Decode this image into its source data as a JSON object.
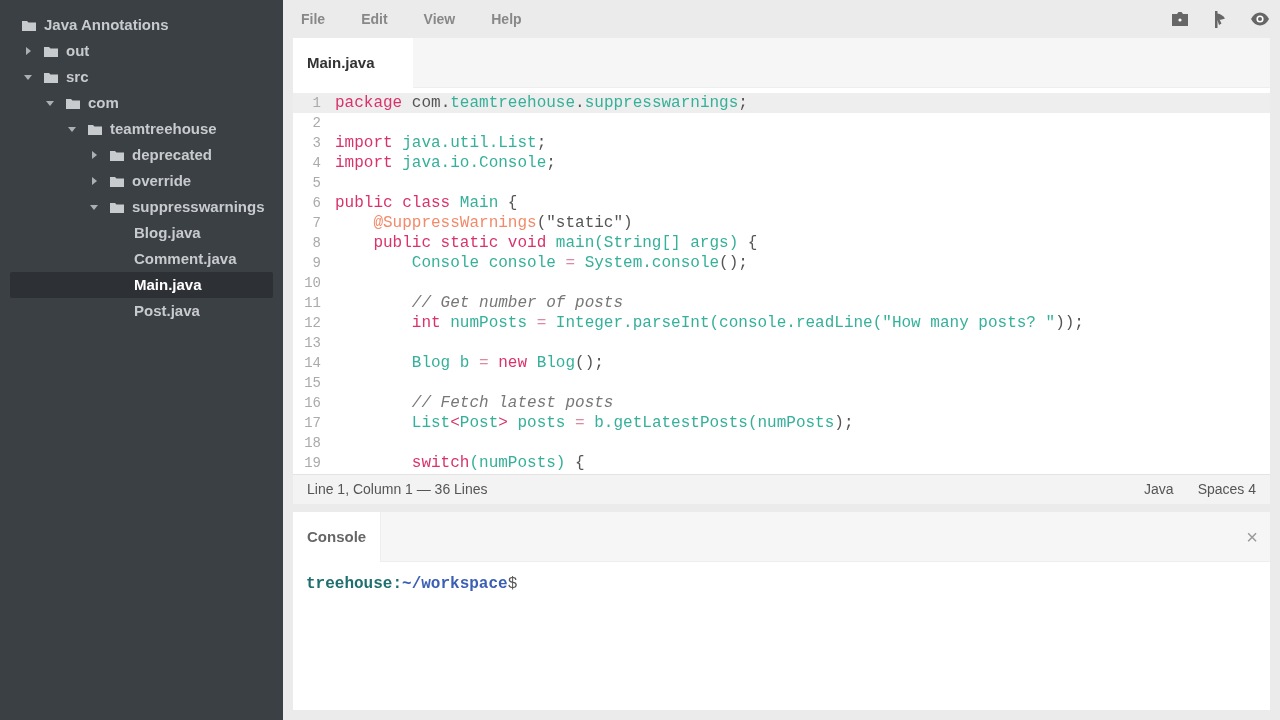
{
  "sidebar": {
    "tree": [
      {
        "label": "Java Annotations",
        "kind": "root",
        "selected": false,
        "children": [
          {
            "label": "out",
            "kind": "folder",
            "expanded": false,
            "selected": false
          },
          {
            "label": "src",
            "kind": "folder",
            "expanded": true,
            "selected": false,
            "children": [
              {
                "label": "com",
                "kind": "folder",
                "expanded": true,
                "selected": false,
                "children": [
                  {
                    "label": "teamtreehouse",
                    "kind": "folder",
                    "expanded": true,
                    "selected": false,
                    "children": [
                      {
                        "label": "deprecated",
                        "kind": "folder",
                        "expanded": false,
                        "selected": false
                      },
                      {
                        "label": "override",
                        "kind": "folder",
                        "expanded": false,
                        "selected": false
                      },
                      {
                        "label": "suppresswarnings",
                        "kind": "folder",
                        "expanded": true,
                        "selected": false,
                        "children": [
                          {
                            "label": "Blog.java",
                            "kind": "file",
                            "selected": false
                          },
                          {
                            "label": "Comment.java",
                            "kind": "file",
                            "selected": false
                          },
                          {
                            "label": "Main.java",
                            "kind": "file",
                            "selected": true
                          },
                          {
                            "label": "Post.java",
                            "kind": "file",
                            "selected": false
                          }
                        ]
                      }
                    ]
                  }
                ]
              }
            ]
          }
        ]
      }
    ]
  },
  "menu": [
    "File",
    "Edit",
    "View",
    "Help"
  ],
  "editor": {
    "tabs": [
      {
        "label": "Main.java",
        "selected": true
      }
    ],
    "lines": [
      {
        "number": "1",
        "current": true,
        "tokens": [
          {
            "text": "package",
            "kind": "keyword"
          },
          {
            "text": " com.",
            "kind": "plain"
          },
          {
            "text": "teamtreehouse",
            "kind": "name"
          },
          {
            "text": ".",
            "kind": "plain"
          },
          {
            "text": "suppresswarnings",
            "kind": "name"
          },
          {
            "text": ";",
            "kind": "plain"
          }
        ]
      },
      {
        "number": "2",
        "current": false
      },
      {
        "number": "3",
        "current": false,
        "tokens": [
          {
            "text": "import",
            "kind": "keyword"
          },
          {
            "text": " java.",
            "kind": "name"
          },
          {
            "text": "util.List",
            "kind": "name"
          },
          {
            "text": ";",
            "kind": "plain"
          }
        ]
      },
      {
        "number": "4",
        "current": false,
        "tokens": [
          {
            "text": "import",
            "kind": "keyword"
          },
          {
            "text": " java.",
            "kind": "name"
          },
          {
            "text": "io.Console",
            "kind": "name"
          },
          {
            "text": ";",
            "kind": "plain"
          }
        ]
      },
      {
        "number": "5",
        "current": false
      },
      {
        "number": "6",
        "current": false,
        "tokens": [
          {
            "text": "public class",
            "kind": "keyword"
          },
          {
            "text": " Main",
            "kind": "name"
          },
          {
            "text": " {",
            "kind": "plain"
          }
        ]
      },
      {
        "number": "7",
        "current": false,
        "tokens": [
          {
            "text": "    @SuppressWarnings",
            "kind": "annotation"
          },
          {
            "text": "(\"static\")",
            "kind": "plain"
          }
        ]
      },
      {
        "number": "8",
        "current": false,
        "tokens": [
          {
            "text": "    public static void",
            "kind": "keyword"
          },
          {
            "text": " main(String[] args)",
            "kind": "name"
          },
          {
            "text": " {",
            "kind": "plain"
          }
        ]
      },
      {
        "number": "9",
        "current": false,
        "tokens": [
          {
            "text": "        Console console",
            "kind": "name"
          },
          {
            "text": " = ",
            "kind": "operator"
          },
          {
            "text": "System.console",
            "kind": "name"
          },
          {
            "text": "();",
            "kind": "plain"
          }
        ]
      },
      {
        "number": "10",
        "current": false
      },
      {
        "number": "11",
        "current": false,
        "tokens": [
          {
            "text": "        // Get number of posts",
            "kind": "comment"
          }
        ]
      },
      {
        "number": "12",
        "current": false,
        "tokens": [
          {
            "text": "        int",
            "kind": "keyword"
          },
          {
            "text": " numPosts",
            "kind": "name"
          },
          {
            "text": " = ",
            "kind": "operator"
          },
          {
            "text": "Integer.parseInt(console.readLine(",
            "kind": "name"
          },
          {
            "text": "\"How many posts? \"",
            "kind": "name"
          },
          {
            "text": "));",
            "kind": "plain"
          }
        ]
      },
      {
        "number": "13",
        "current": false
      },
      {
        "number": "14",
        "current": false,
        "tokens": [
          {
            "text": "        Blog b",
            "kind": "name"
          },
          {
            "text": " = ",
            "kind": "operator"
          },
          {
            "text": "new",
            "kind": "keyword"
          },
          {
            "text": " Blog",
            "kind": "name"
          },
          {
            "text": "();",
            "kind": "plain"
          }
        ]
      },
      {
        "number": "15",
        "current": false
      },
      {
        "number": "16",
        "current": false,
        "tokens": [
          {
            "text": "        // Fetch latest posts",
            "kind": "comment"
          }
        ]
      },
      {
        "number": "17",
        "current": false,
        "tokens": [
          {
            "text": "        List",
            "kind": "name"
          },
          {
            "text": "<",
            "kind": "keyword"
          },
          {
            "text": "Post",
            "kind": "name"
          },
          {
            "text": ">",
            "kind": "keyword"
          },
          {
            "text": " posts",
            "kind": "name"
          },
          {
            "text": " = ",
            "kind": "operator"
          },
          {
            "text": "b.getLatestPosts(numPosts",
            "kind": "name"
          },
          {
            "text": ");",
            "kind": "plain"
          }
        ]
      },
      {
        "number": "18",
        "current": false
      },
      {
        "number": "19",
        "current": false,
        "tokens": [
          {
            "text": "        switch",
            "kind": "keyword"
          },
          {
            "text": "(numPosts)",
            "kind": "name"
          },
          {
            "text": " {",
            "kind": "plain"
          }
        ]
      }
    ],
    "status": {
      "position": "Line 1, Column 1 — 36 Lines",
      "language": "Java",
      "indent": "Spaces 4"
    }
  },
  "console": {
    "tabs": [
      {
        "label": "Console",
        "selected": true
      }
    ],
    "close": "×",
    "prompt": {
      "user": "treehouse",
      "separator": ":",
      "path": "~/workspace",
      "symbol": "$"
    }
  }
}
